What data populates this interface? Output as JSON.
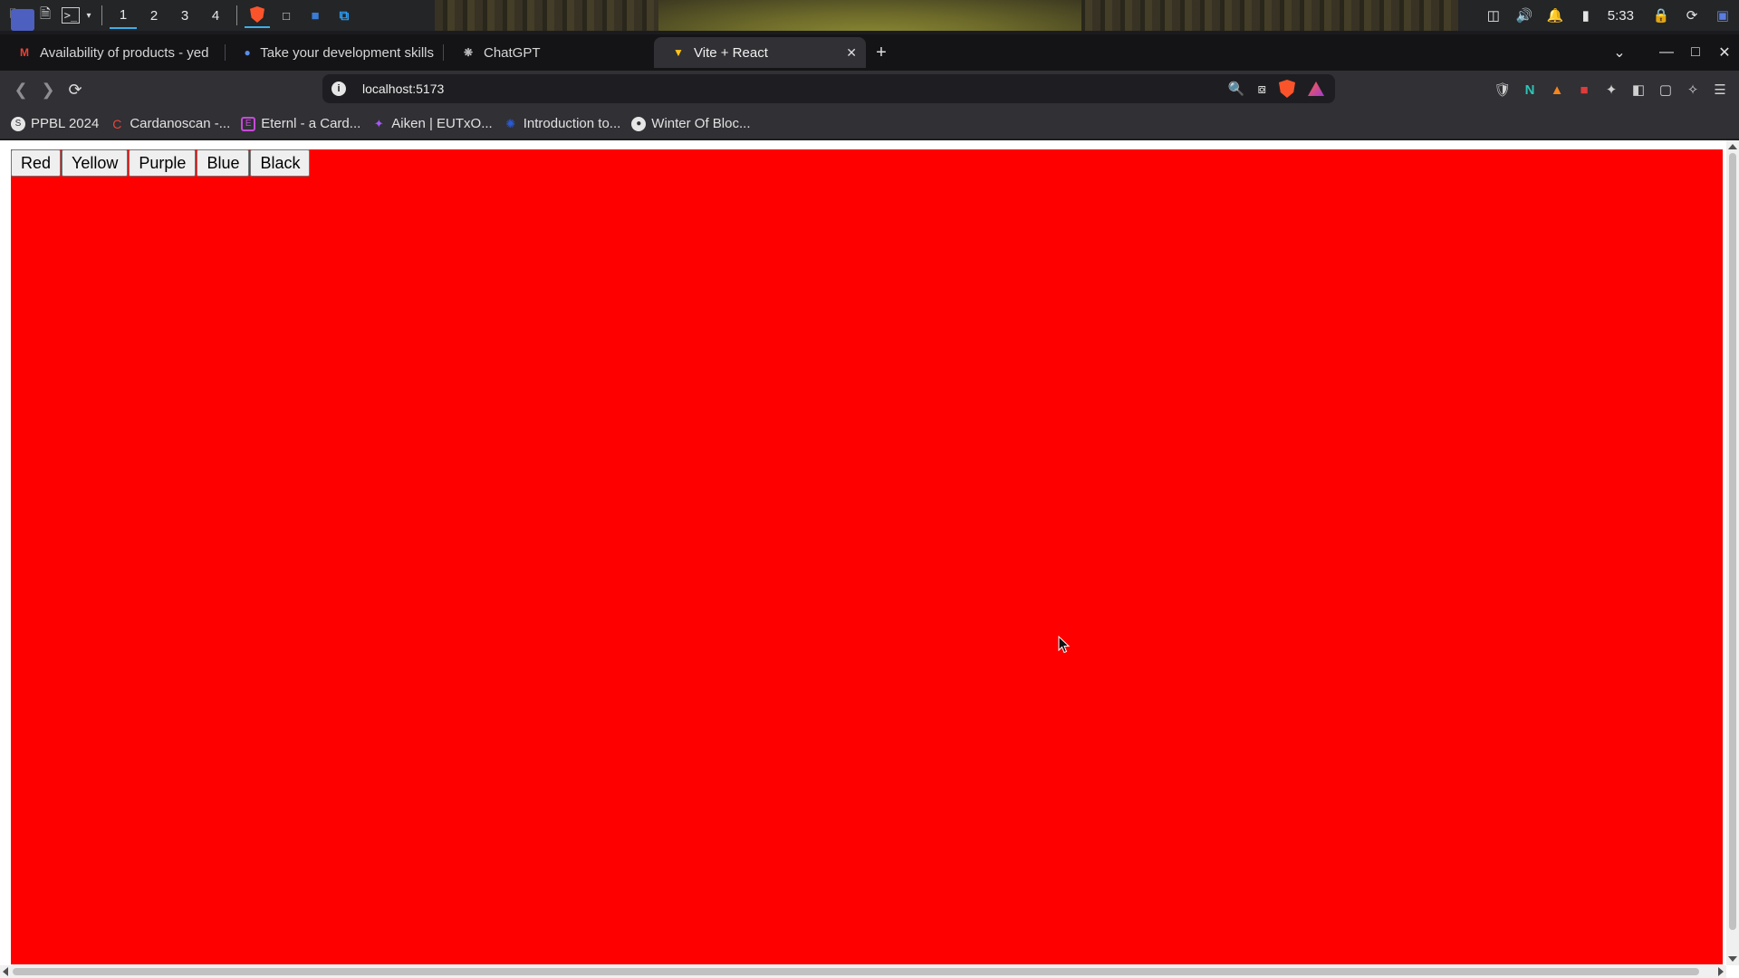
{
  "taskbar": {
    "workspaces": [
      "1",
      "2",
      "3",
      "4"
    ],
    "clock": "5:33"
  },
  "tabs": [
    {
      "title": "Availability of products - yed",
      "favicon": "gmail-icon"
    },
    {
      "title": "Take your development skills",
      "favicon": "globe-icon"
    },
    {
      "title": "ChatGPT",
      "favicon": "chatgpt-icon"
    },
    {
      "title": "Vite + React",
      "favicon": "vite-icon",
      "active": true
    }
  ],
  "toolbar": {
    "url": "localhost:5173"
  },
  "bookmarks": [
    {
      "label": "PPBL 2024",
      "icon": "ppbl-icon"
    },
    {
      "label": "Cardanoscan -...",
      "icon": "cardanoscan-icon"
    },
    {
      "label": "Eternl - a Card...",
      "icon": "eternl-icon"
    },
    {
      "label": "Aiken | EUTxO...",
      "icon": "aiken-icon"
    },
    {
      "label": "Introduction to...",
      "icon": "cardano-icon"
    },
    {
      "label": "Winter Of Bloc...",
      "icon": "github-icon"
    }
  ],
  "app": {
    "background_color": "#ff0000",
    "buttons": [
      "Red",
      "Yellow",
      "Purple",
      "Blue",
      "Black"
    ]
  }
}
